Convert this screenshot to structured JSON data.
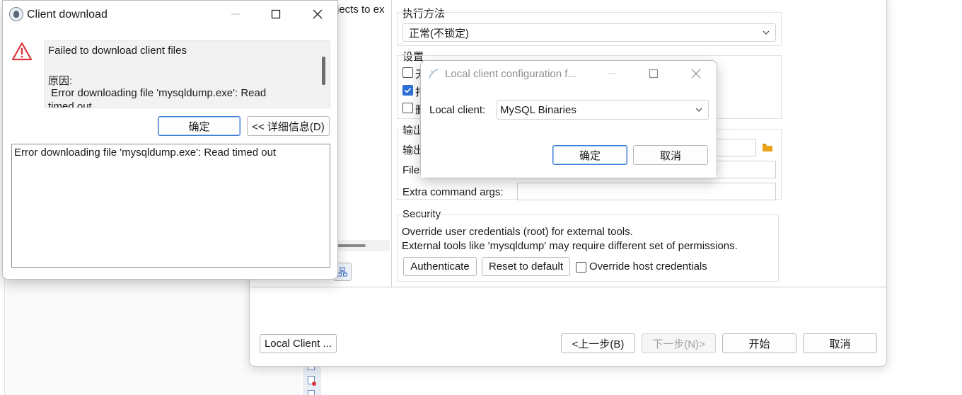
{
  "main_wizard": {
    "top_left_text": "jects to ex",
    "exec_method_label": "执行方法",
    "exec_method_value": "正常(不锁定)",
    "settings_label": "设置",
    "settings_checkbox_1_label": "无",
    "settings_checkbox_2_label": "打",
    "settings_checkbox_3_label": "删",
    "output_group_label": "输出",
    "output_folder_label": "输出",
    "file_label": "File",
    "extra_args_label": "Extra command args:",
    "extra_args_value": "",
    "security_label": "Security",
    "security_line1": "Override user credentials (root) for external tools.",
    "security_line2": "External tools like 'mysqldump' may require different set of permissions.",
    "authenticate_label": "Authenticate",
    "reset_label": "Reset to default",
    "override_host_label": "Override host credentials",
    "local_client_btn": "Local Client ...",
    "prev_btn": "<上一步(B)",
    "next_btn": "下一步(N)>",
    "start_btn": "开始",
    "cancel_btn": "取消"
  },
  "client_download": {
    "title": "Client download",
    "message_title": "Failed to download client files",
    "reason_label": "原因:",
    "reason_text": "Error downloading file 'mysqldump.exe': Read",
    "reason_text_cont": "timed out",
    "ok_btn": "确定",
    "details_btn": "<< 详细信息(D)",
    "details_text": "Error downloading file 'mysqldump.exe': Read timed out"
  },
  "local_client_config": {
    "title": "Local client configuration f...",
    "local_client_label": "Local client:",
    "local_client_value": "MySQL Binaries",
    "ok_btn": "确定",
    "cancel_btn": "取消"
  },
  "colors": {
    "accent": "#2e6fd6",
    "warning": "#d9363e",
    "folder": "#e8a317"
  }
}
